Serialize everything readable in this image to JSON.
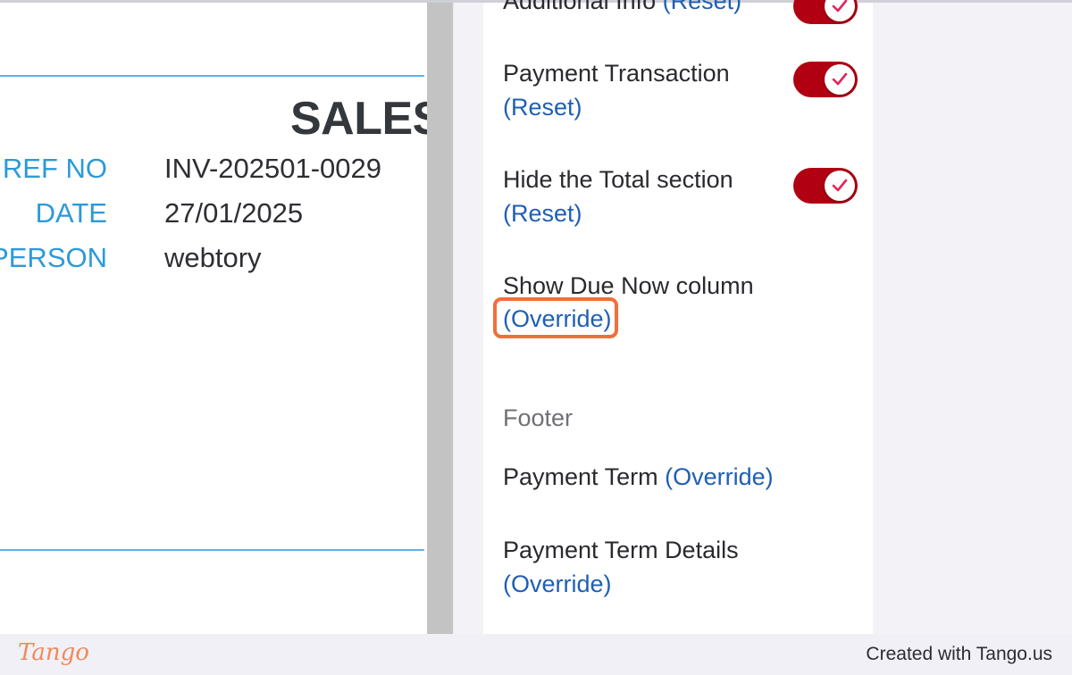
{
  "invoice": {
    "title": "SALES",
    "fields": [
      {
        "label": "REF NO",
        "value": "INV-202501-0029"
      },
      {
        "label": "DATE",
        "value": "27/01/2025"
      },
      {
        "label": "PERSON",
        "value": "webtory"
      }
    ]
  },
  "settings": {
    "items": [
      {
        "label": "Additional Info",
        "action": "(Reset)",
        "toggle": "on"
      },
      {
        "label": "Payment Transaction",
        "action": "(Reset)",
        "toggle": "on"
      },
      {
        "label": "Hide the Total section",
        "action": "(Reset)",
        "toggle": "on"
      },
      {
        "label": "Show Due Now column",
        "action": "(Override)"
      }
    ],
    "footer_section": {
      "heading": "Footer",
      "items": [
        {
          "label": "Payment Term",
          "action": "(Override)"
        },
        {
          "label": "Payment Term Details",
          "action": "(Override)"
        }
      ]
    }
  },
  "colors": {
    "toggle_on": "#b10012",
    "check": "#e0265a",
    "link": "#1f5fb3",
    "highlight": "#f0703a",
    "invoice_label": "#2b9ad9"
  },
  "footer": {
    "logo": "Tango",
    "credit": "Created with Tango.us"
  }
}
